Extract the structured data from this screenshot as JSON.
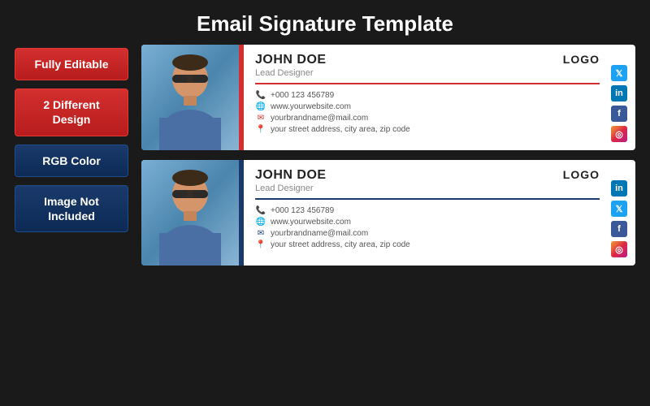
{
  "page": {
    "title": "Email Signature Template",
    "background": "#1a1a1a"
  },
  "badges": [
    {
      "id": "fully-editable",
      "text": "Fully Editable",
      "style": "red"
    },
    {
      "id": "different-design",
      "text": "2 Different Design",
      "style": "red"
    },
    {
      "id": "rgb-color",
      "text": "RGB Color",
      "style": "blue"
    },
    {
      "id": "image-not-included",
      "text": "Image Not Included",
      "style": "blue"
    }
  ],
  "card1": {
    "name": "JOHN DOE",
    "title": "Lead Designer",
    "logo": "LOGO",
    "phone": "+000 123 456789",
    "website": "www.yourwebsite.com",
    "email": "yourbrandname@mail.com",
    "address": "your street address, city area, zip code",
    "theme": "red"
  },
  "card2": {
    "name": "JOHN DOE",
    "title": "Lead Designer",
    "logo": "LOGO",
    "phone": "+000 123 456789",
    "website": "www.yourwebsite.com",
    "email": "yourbrandname@mail.com",
    "address": "your street address, city area, zip code",
    "theme": "blue"
  }
}
